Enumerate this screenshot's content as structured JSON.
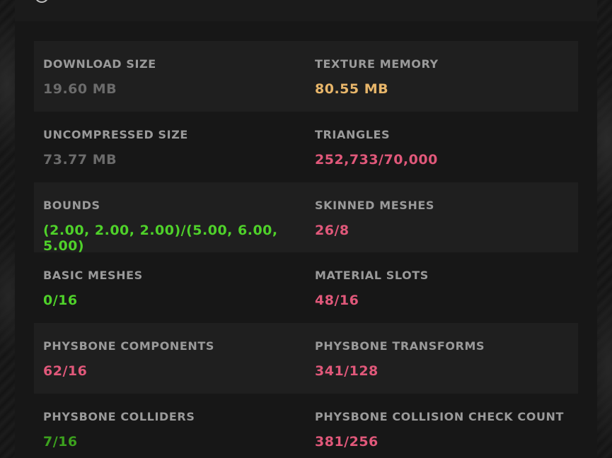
{
  "colors": {
    "neutral": "#6b6b6b",
    "warning": "#e8b66a",
    "over_limit": "#e0587a",
    "ok": "#4fd12a",
    "ok_dim": "#3ca11e"
  },
  "header": {
    "icon": "info-icon"
  },
  "stats": [
    {
      "label": "DOWNLOAD SIZE",
      "value": "19.60 MB",
      "status": "neutral"
    },
    {
      "label": "TEXTURE MEMORY",
      "value": "80.55 MB",
      "status": "warning"
    },
    {
      "label": "UNCOMPRESSED SIZE",
      "value": "73.77 MB",
      "status": "neutral"
    },
    {
      "label": "TRIANGLES",
      "value": "252,733/70,000",
      "status": "over_limit"
    },
    {
      "label": "BOUNDS",
      "value": "(2.00, 2.00, 2.00)/(5.00, 6.00, 5.00)",
      "status": "ok"
    },
    {
      "label": "SKINNED MESHES",
      "value": "26/8",
      "status": "over_limit"
    },
    {
      "label": "BASIC MESHES",
      "value": "0/16",
      "status": "ok"
    },
    {
      "label": "MATERIAL SLOTS",
      "value": "48/16",
      "status": "over_limit"
    },
    {
      "label": "PHYSBONE COMPONENTS",
      "value": "62/16",
      "status": "over_limit"
    },
    {
      "label": "PHYSBONE TRANSFORMS",
      "value": "341/128",
      "status": "over_limit"
    },
    {
      "label": "PHYSBONE COLLIDERS",
      "value": "7/16",
      "status": "ok_dim"
    },
    {
      "label": "PHYSBONE COLLISION CHECK COUNT",
      "value": "381/256",
      "status": "over_limit"
    }
  ]
}
